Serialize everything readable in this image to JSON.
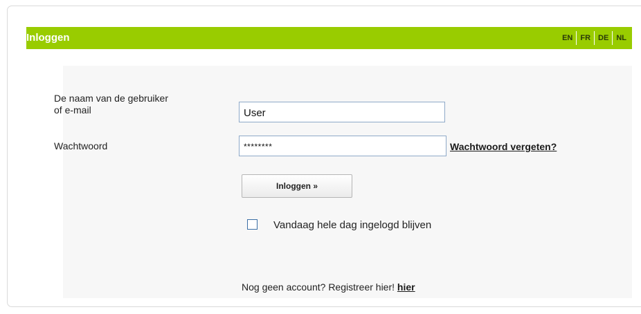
{
  "header": {
    "title": "Inloggen",
    "languages": [
      "EN",
      "FR",
      "DE",
      "NL"
    ]
  },
  "form": {
    "username_label_line1": "De naam van de gebruiker",
    "username_label_line2": "of e-mail",
    "username_value": "User",
    "password_label": "Wachtwoord",
    "password_value": "********",
    "forgot_password_link": "Wachtwoord vergeten?",
    "login_button": "Inloggen »",
    "remember_label": "Vandaag hele dag ingelogd blijven",
    "remember_checked": false,
    "register_text": "Nog geen account? Registreer hier!",
    "register_link": "hier"
  },
  "colors": {
    "header_bg": "#99cc00",
    "content_bg": "#f7f7f7",
    "input_border": "#8ea9c8",
    "checkbox_border": "#3a6ea5"
  }
}
